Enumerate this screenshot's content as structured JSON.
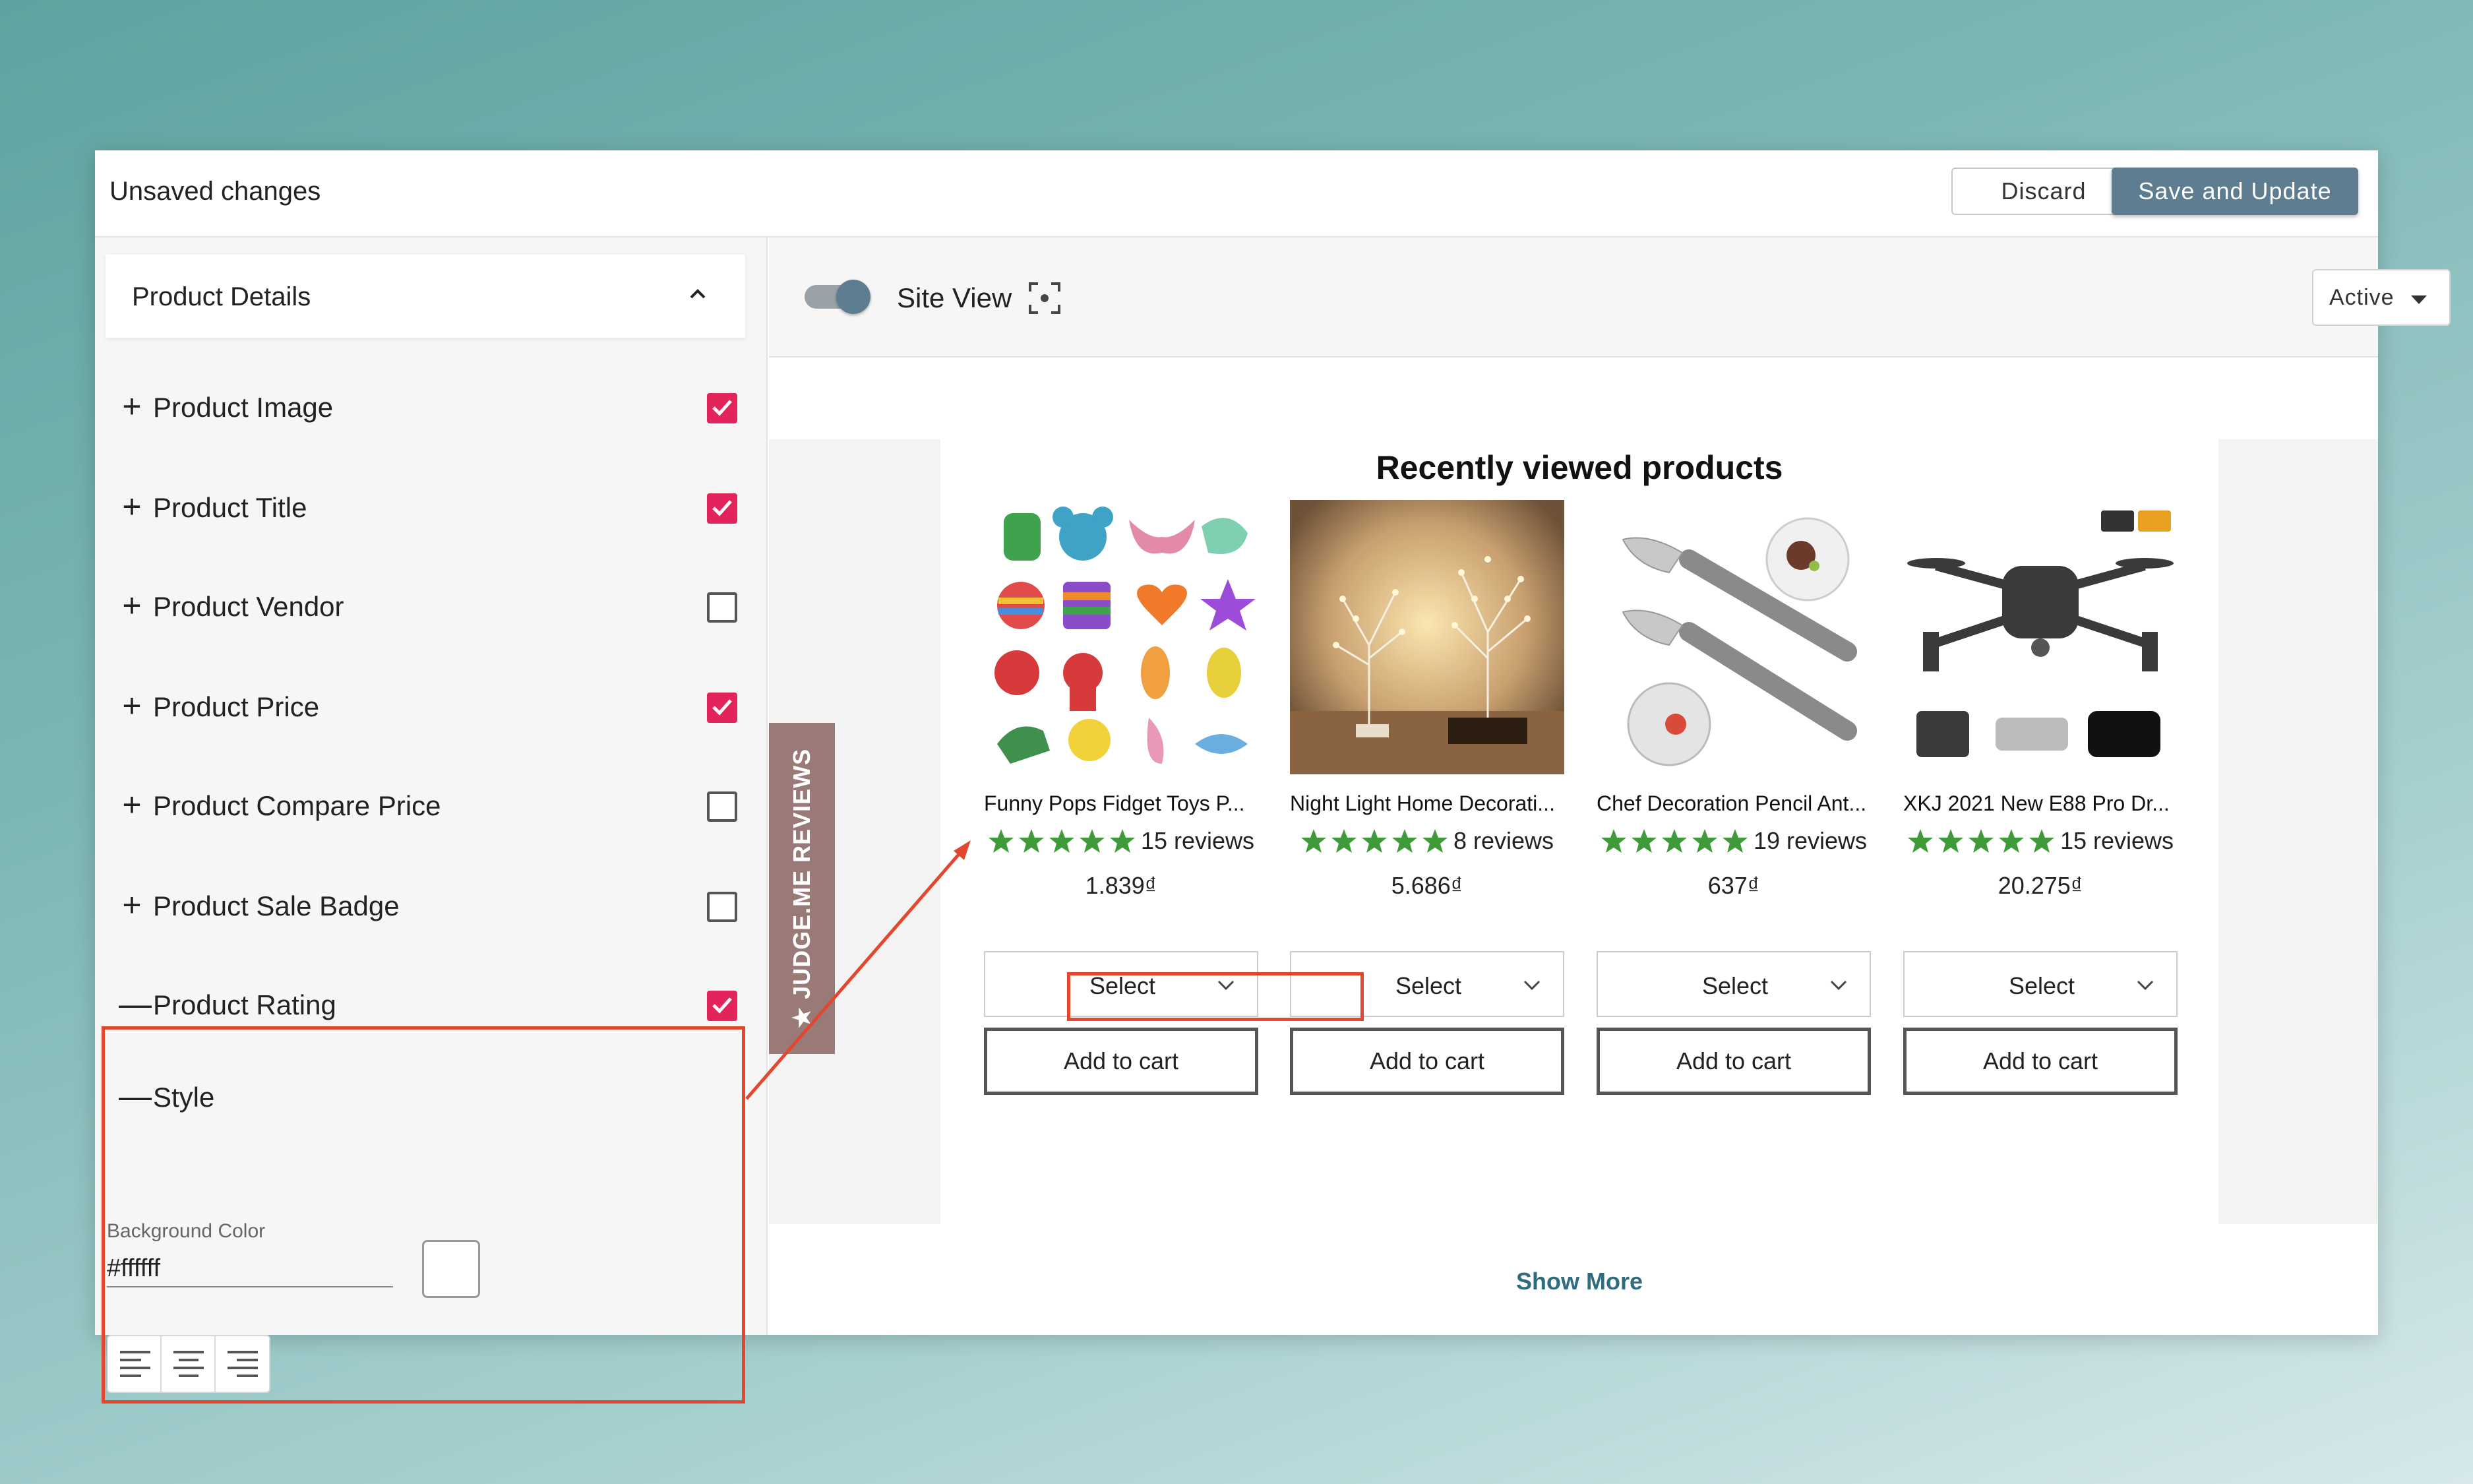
{
  "topbar": {
    "title": "Unsaved changes",
    "discard_label": "Discard",
    "save_label": "Save and Update"
  },
  "sidebar": {
    "section_title": "Product Details",
    "items": [
      {
        "label": "Product Image",
        "sign": "+",
        "checked": true
      },
      {
        "label": "Product Title",
        "sign": "+",
        "checked": true
      },
      {
        "label": "Product Vendor",
        "sign": "+",
        "checked": false
      },
      {
        "label": "Product Price",
        "sign": "+",
        "checked": true
      },
      {
        "label": "Product Compare Price",
        "sign": "+",
        "checked": false
      },
      {
        "label": "Product Sale Badge",
        "sign": "+",
        "checked": false
      },
      {
        "label": "Product Rating",
        "sign": "—",
        "checked": true
      }
    ],
    "style": {
      "label": "Style",
      "sign": "—",
      "bg_color_label": "Background Color",
      "bg_color_value": "#ffffff"
    }
  },
  "preview": {
    "site_view_label": "Site View",
    "status_value": "Active",
    "judge_tab_label": "★ JUDGE.ME REVIEWS",
    "section_title": "Recently viewed products",
    "show_more": "Show More",
    "products": [
      {
        "name": "Funny Pops Fidget Toys P...",
        "reviews": "15 reviews",
        "price": "1.839₫",
        "select_label": "Select",
        "cart_label": "Add to cart"
      },
      {
        "name": "Night Light Home Decorati...",
        "reviews": "8 reviews",
        "price": "5.686₫",
        "select_label": "Select",
        "cart_label": "Add to cart"
      },
      {
        "name": "Chef Decoration Pencil Ant...",
        "reviews": "19 reviews",
        "price": "637₫",
        "select_label": "Select",
        "cart_label": "Add to cart"
      },
      {
        "name": "XKJ 2021 New E88 Pro Dr...",
        "reviews": "15 reviews",
        "price": "20.275₫",
        "select_label": "Select",
        "cart_label": "Add to cart"
      }
    ]
  },
  "colors": {
    "accent": "#5f7d90",
    "checkbox": "#e3245a",
    "stars": "#3f9a3a",
    "highlight": "#e2472f",
    "link": "#2e6c80"
  }
}
